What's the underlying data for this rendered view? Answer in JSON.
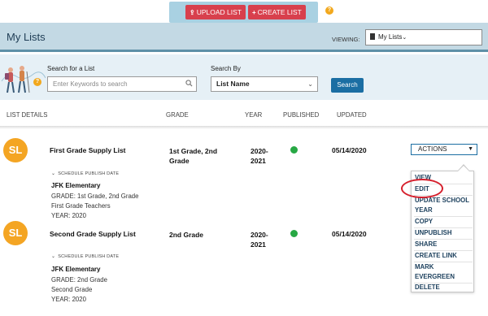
{
  "toolbar": {
    "upload_label": "UPLOAD LIST",
    "create_label": "CREATE LIST",
    "help_icon": "?"
  },
  "header": {
    "title": "My Lists",
    "viewing_label": "VIEWING:",
    "viewing_value": "My Lists"
  },
  "search": {
    "label": "Search for a List",
    "placeholder": "Enter Keywords to search",
    "by_label": "Search By",
    "by_value": "List Name",
    "button": "Search",
    "help_icon": "?"
  },
  "table": {
    "columns": [
      "LIST DETAILS",
      "GRADE",
      "YEAR",
      "PUBLISHED",
      "UPDATED"
    ],
    "rows": [
      {
        "initials": "SL",
        "name": "First Grade Supply List",
        "grade_line1": "1st Grade, 2nd",
        "grade_line2": "Grade",
        "year_line1": "2020-",
        "year_line2": "2021",
        "published": true,
        "updated": "05/14/2020",
        "schedule": "SCHEDULE PUBLISH DATE",
        "school": "JFK Elementary",
        "details": [
          "GRADE: 1st Grade, 2nd Grade",
          "First Grade Teachers",
          "YEAR: 2020"
        ]
      },
      {
        "initials": "SL",
        "name": "Second Grade Supply List",
        "grade_line1": "2nd Grade",
        "grade_line2": "",
        "year_line1": "2020-",
        "year_line2": "2021",
        "published": true,
        "updated": "05/14/2020",
        "schedule": "SCHEDULE PUBLISH DATE",
        "school": "JFK Elementary",
        "details": [
          "GRADE: 2nd Grade",
          "Second Grade",
          "YEAR: 2020"
        ]
      }
    ]
  },
  "actions": {
    "label": "ACTIONS",
    "menu": [
      "VIEW",
      "EDIT",
      "UPDATE SCHOOL YEAR",
      "COPY",
      "UNPUBLISH",
      "SHARE",
      "CREATE LINK",
      "MARK EVERGREEN",
      "DELETE"
    ],
    "menu_display": [
      "VIEW",
      "EDIT",
      "UPDATE SCHOOL",
      "YEAR",
      "COPY",
      "UNPUBLISH",
      "SHARE",
      "CREATE LINK",
      "MARK",
      "EVERGREEN",
      "DELETE"
    ]
  },
  "colors": {
    "accent_red": "#d8404d",
    "header_bg": "#c3d9e4",
    "avatar": "#f4a523",
    "published_dot": "#27a844",
    "primary_blue": "#1b6ea3",
    "highlight_ring": "#d61f2c"
  },
  "icons": {
    "upload": "upload-icon",
    "create": "plus-icon",
    "help": "help-icon",
    "search": "search-icon",
    "document": "document-icon",
    "chevron": "chevron-down-icon"
  }
}
